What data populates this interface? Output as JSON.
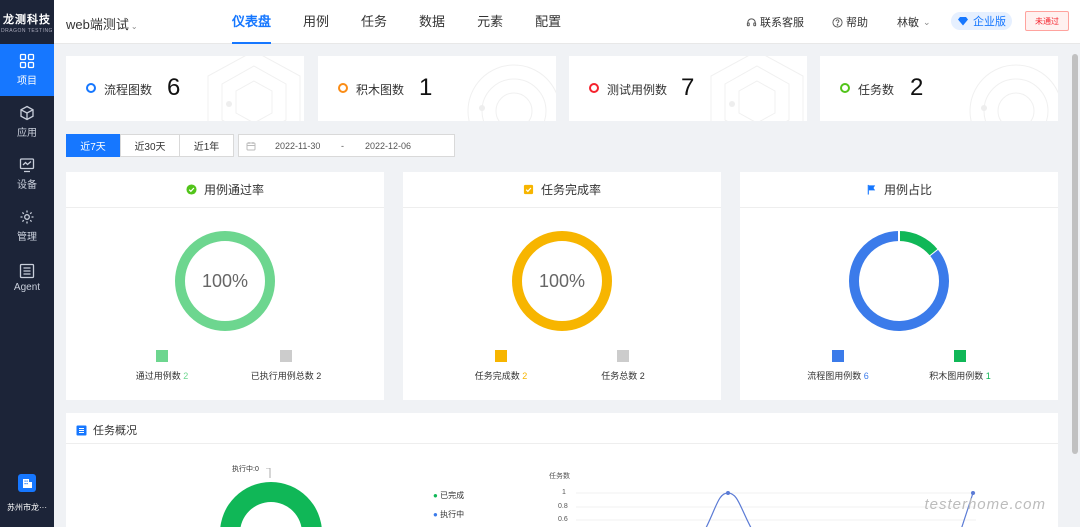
{
  "sidebar": {
    "logo_title": "龙测科技",
    "logo_sub": "DRAGON TESTING",
    "items": [
      {
        "label": "项目",
        "active": true
      },
      {
        "label": "应用"
      },
      {
        "label": "设备"
      },
      {
        "label": "管理"
      },
      {
        "label": "Agent"
      }
    ],
    "org_label": "苏州市龙···"
  },
  "header": {
    "project": "web端测试",
    "tabs": [
      "仪表盘",
      "用例",
      "任务",
      "数据",
      "元素",
      "配置"
    ],
    "active_tab": "仪表盘",
    "support": "联系客服",
    "help": "帮助",
    "user": "林敏",
    "edition": "企业版",
    "status": "未通过"
  },
  "stats": [
    {
      "label": "流程图数",
      "value": "6",
      "color": "#1677ff"
    },
    {
      "label": "积木图数",
      "value": "1",
      "color": "#fa8c16"
    },
    {
      "label": "测试用例数",
      "value": "7",
      "color": "#f5222d"
    },
    {
      "label": "任务数",
      "value": "2",
      "color": "#52c41a"
    }
  ],
  "range": {
    "options": [
      "近7天",
      "近30天",
      "近1年"
    ],
    "selected": "近7天",
    "start": "2022-11-30",
    "sep": "-",
    "end": "2022-12-06"
  },
  "cards": [
    {
      "title": "用例通过率",
      "percent_text": "100%",
      "ring_fraction": 1.0,
      "legend": [
        {
          "label": "通过用例数",
          "value": "2",
          "color": "#6dd68f"
        },
        {
          "label": "已执行用例总数",
          "value": "2",
          "color": "#cccccc"
        }
      ]
    },
    {
      "title": "任务完成率",
      "percent_text": "100%",
      "ring_fraction": 1.0,
      "legend": [
        {
          "label": "任务完成数",
          "value": "2",
          "color": "#f7b500"
        },
        {
          "label": "任务总数",
          "value": "2",
          "color": "#cccccc"
        }
      ]
    },
    {
      "title": "用例占比",
      "legend": [
        {
          "label": "流程图用例数",
          "value": "6",
          "color": "#3b7bea"
        },
        {
          "label": "积木图用例数",
          "value": "1",
          "color": "#10b757"
        }
      ]
    }
  ],
  "overview": {
    "title": "任务概况",
    "donut_label": "执行中:0",
    "legend_done": "已完成",
    "legend_running": "执行中",
    "line_ylabel": "任务数",
    "line_ticks": [
      "1",
      "0.8",
      "0.6"
    ]
  },
  "watermark": "testerhome.com"
}
